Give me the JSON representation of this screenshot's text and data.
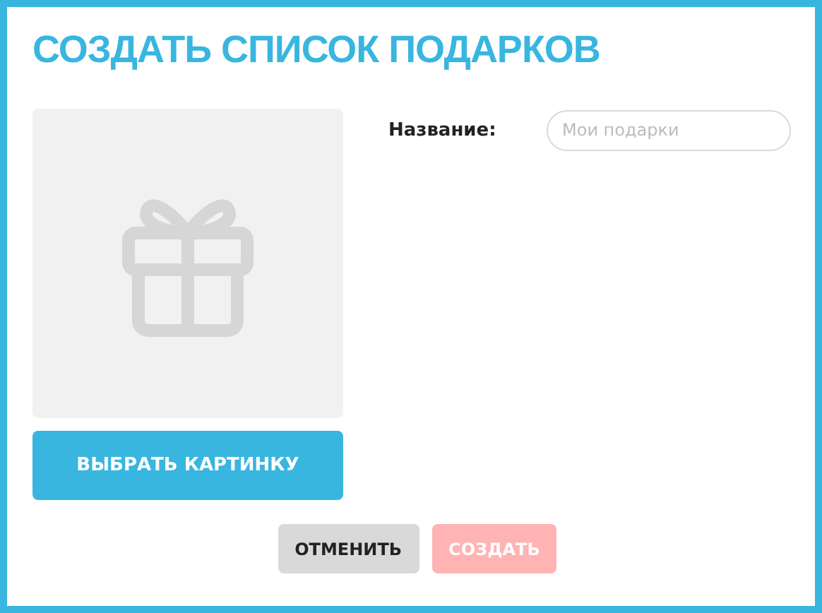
{
  "title": "СОЗДАТЬ СПИСОК ПОДАРКОВ",
  "image": {
    "button": "ВЫБРАТЬ КАРТИНКУ"
  },
  "name_field": {
    "label": "Название:",
    "placeholder": "Мои подарки"
  },
  "buttons": [
    {
      "kind": "cancel",
      "label": "ОТМЕНИТЬ",
      "disabled": false
    },
    {
      "kind": "create",
      "label": "СОЗДАТЬ",
      "disabled": true
    }
  ]
}
